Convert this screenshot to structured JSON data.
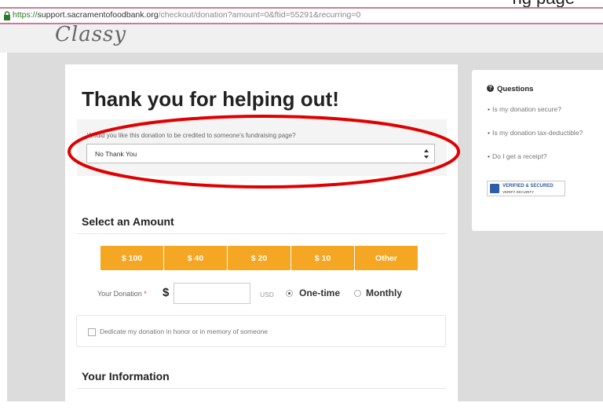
{
  "caption_fragment": "ng page",
  "browser": {
    "url_scheme": "https://",
    "url_host": "support.sacramentofoodbank.org",
    "url_path": "/checkout/donation?amount=0&ftid=55291&recurring=0"
  },
  "header": {
    "logo_text": "Classy"
  },
  "main": {
    "title": "Thank you for helping out!",
    "fundraising": {
      "label": "Would you like this donation to be credited to someone's fundraising page?",
      "selected": "No Thank You"
    },
    "amount_section": {
      "heading": "Select an Amount",
      "buttons": [
        "$ 100",
        "$ 40",
        "$ 20",
        "$ 10",
        "Other"
      ]
    },
    "donation": {
      "label": "Your Donation",
      "required_mark": "*",
      "currency_symbol": "$",
      "value": "",
      "currency": "USD",
      "frequency_options": [
        "One-time",
        "Monthly"
      ],
      "selected_frequency": "One-time"
    },
    "dedicate_label": "Dedicate my donation in honor or in memory of someone",
    "info_heading": "Your Information"
  },
  "sidebar": {
    "title": "Questions",
    "links": [
      "Is my donation secure?",
      "Is my donation tax-deductible?",
      "Do I get a receipt?"
    ],
    "badge_line1": "VERIFIED & SECURED",
    "badge_line2": "VERIFY SECURITY"
  },
  "colors": {
    "amount_button": "#f5a623",
    "highlight_ellipse": "#e00000",
    "url_bar_border": "#c97b9b"
  }
}
